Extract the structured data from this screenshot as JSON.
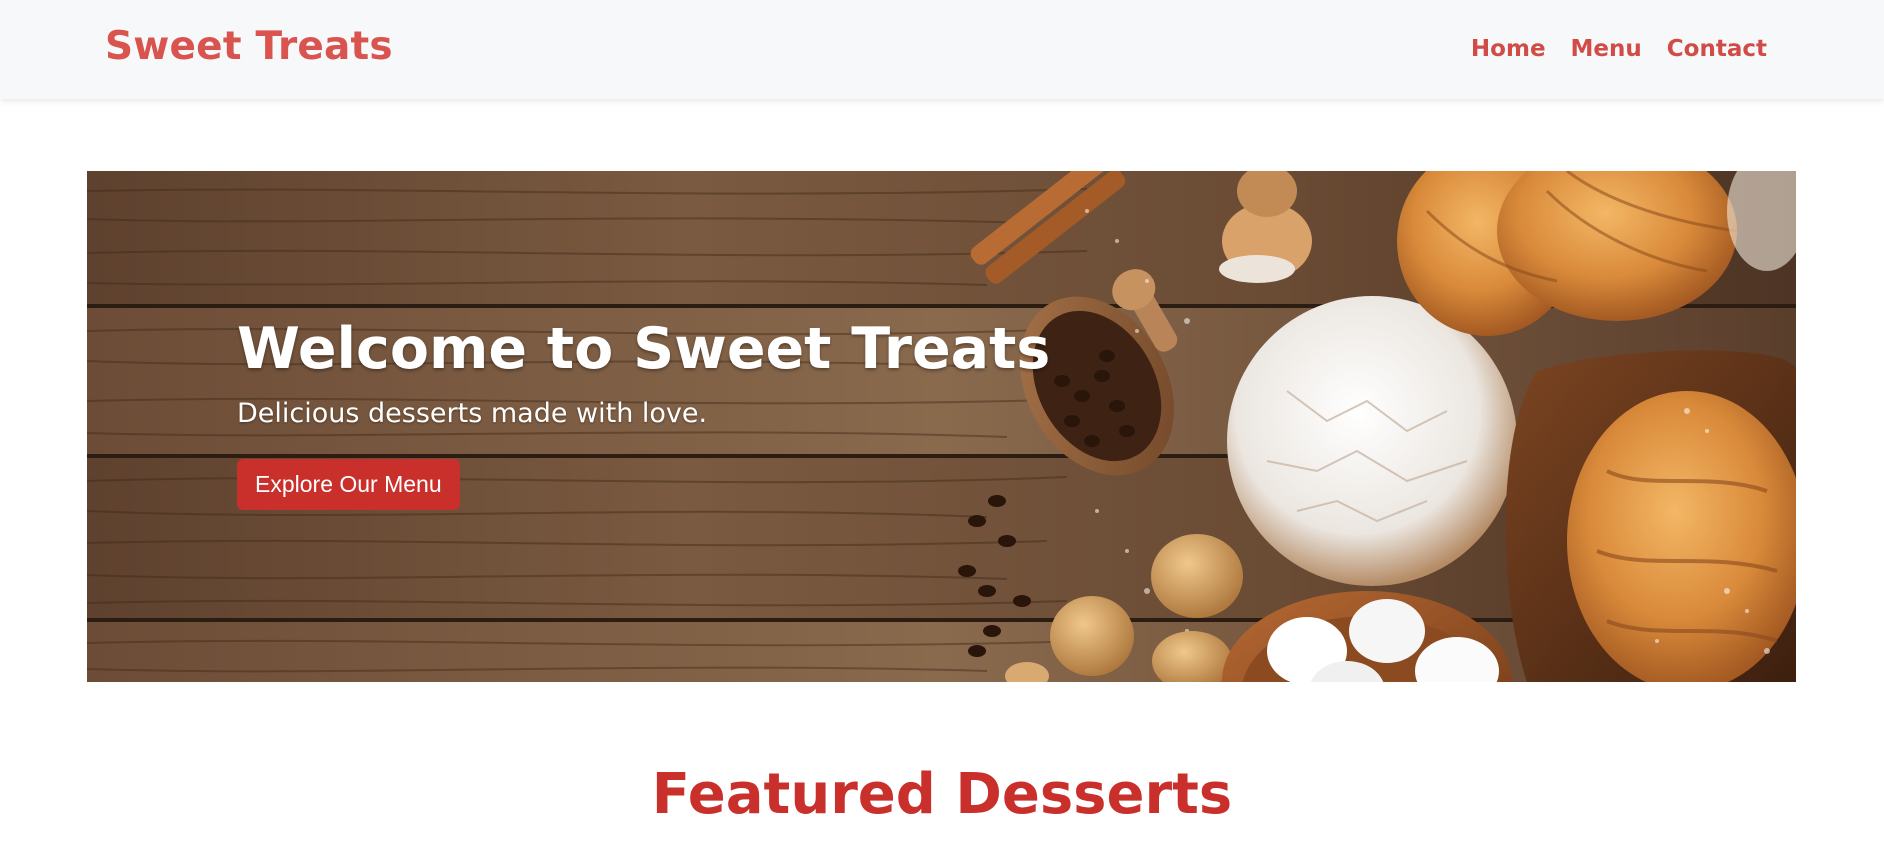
{
  "navbar": {
    "brand": "Sweet Treats",
    "links": [
      {
        "label": "Home"
      },
      {
        "label": "Menu"
      },
      {
        "label": "Contact"
      }
    ]
  },
  "hero": {
    "title": "Welcome to Sweet Treats",
    "subtitle": "Delicious desserts made with love.",
    "button_label": "Explore Our Menu"
  },
  "featured": {
    "title": "Featured Desserts"
  },
  "colors": {
    "brand": "#d9534f",
    "accent": "#c9302c",
    "navbar_bg": "#f7f8f9",
    "wood": "#6b4a33"
  }
}
